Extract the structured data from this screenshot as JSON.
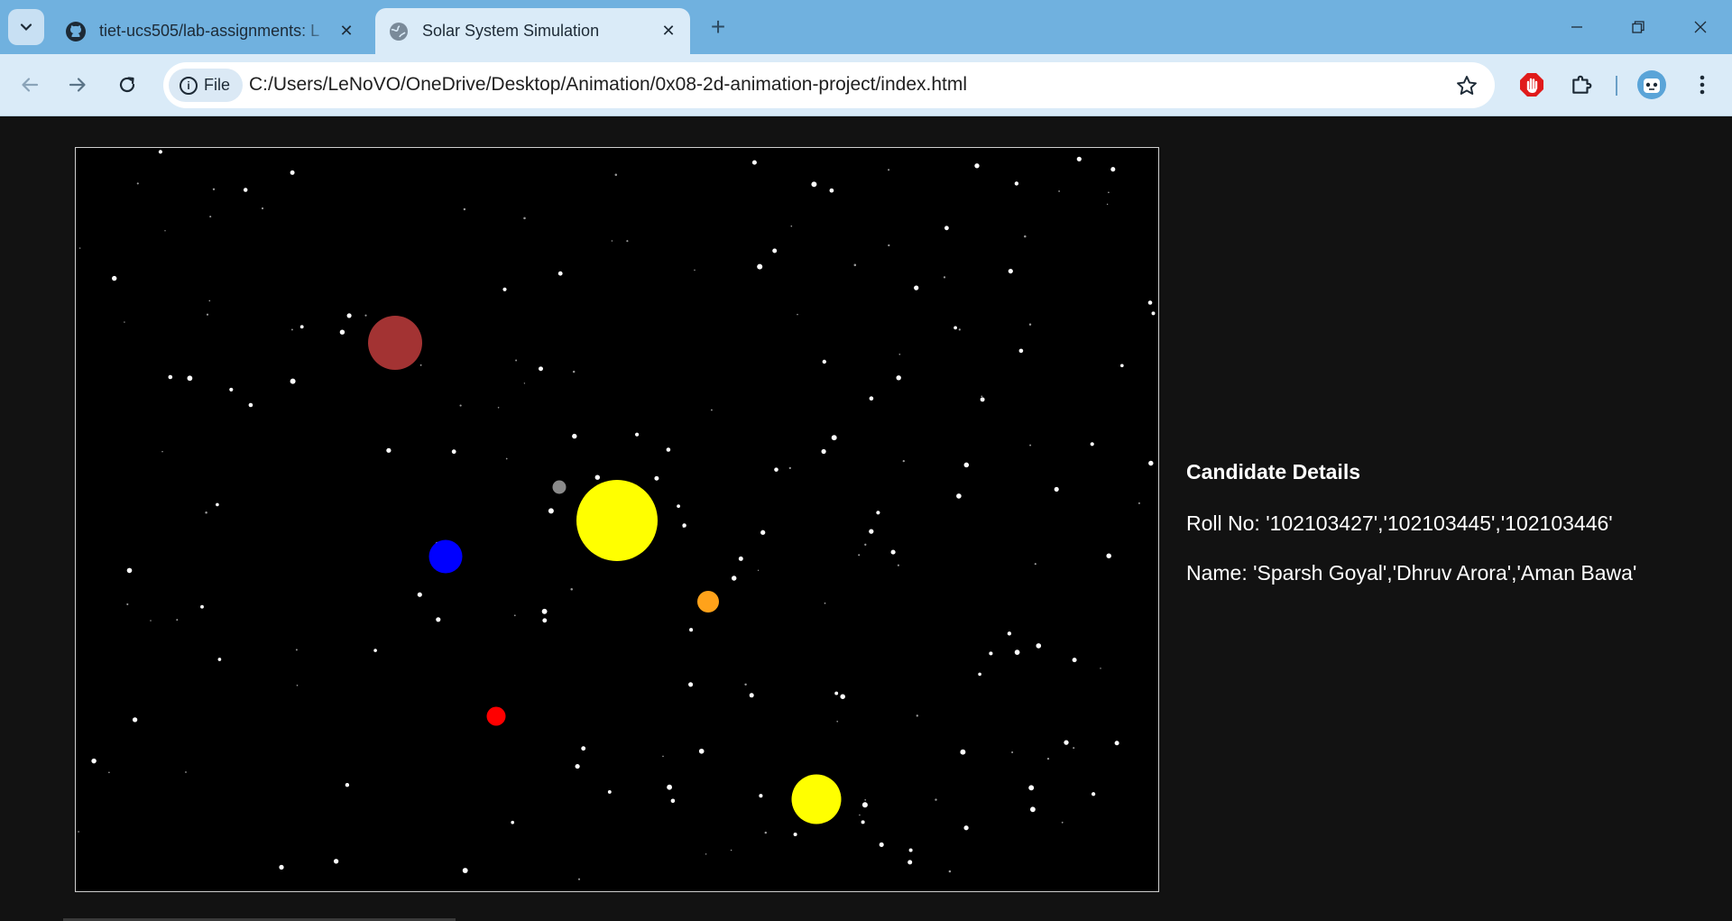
{
  "browser": {
    "tabs": [
      {
        "title": "tiet-ucs505/lab-assignments: L",
        "icon": "github-icon",
        "active": false
      },
      {
        "title": "Solar System Simulation",
        "icon": "globe-icon",
        "active": true
      }
    ],
    "address_chip": "File",
    "url": "C:/Users/LeNoVO/OneDrive/Desktop/Animation/0x08-2d-animation-project/index.html"
  },
  "page": {
    "heading": "Candidate Details",
    "roll_no": "Roll No: '102103427','102103445','102103446'",
    "name": "Name: 'Sparsh Goyal','Dhruv Arora','Aman Bawa'"
  },
  "colors": {
    "tab_strip": "#70b1df",
    "toolbar": "#daebf8",
    "page_background": "#121212",
    "canvas_background": "#000000"
  }
}
